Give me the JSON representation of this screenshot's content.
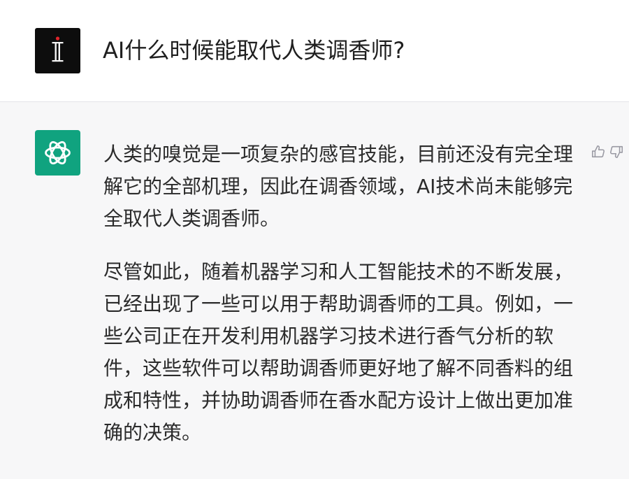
{
  "user_message": {
    "avatar_icon": "user-avatar-logo",
    "text": "AI什么时候能取代人类调香师?"
  },
  "assistant_message": {
    "avatar_icon": "openai-logo-icon",
    "paragraphs": [
      "人类的嗅觉是一项复杂的感官技能，目前还没有完全理解它的全部机理，因此在调香领域，AI技术尚未能够完全取代人类调香师。",
      "尽管如此，随着机器学习和人工智能技术的不断发展，已经出现了一些可以用于帮助调香师的工具。例如，一些公司正在开发利用机器学习技术进行香气分析的软件，这些软件可以帮助调香师更好地了解不同香料的组成和特性，并协助调香师在香水配方设计上做出更加准确的决策。"
    ],
    "feedback": {
      "thumbs_up_icon": "thumbs-up-icon",
      "thumbs_down_icon": "thumbs-down-icon"
    }
  },
  "colors": {
    "assistant_avatar_bg": "#10a37f",
    "user_avatar_bg": "#0d0d0d",
    "user_row_bg": "#ffffff",
    "assistant_row_bg": "#f7f7f8",
    "text": "#2b2b2b"
  }
}
